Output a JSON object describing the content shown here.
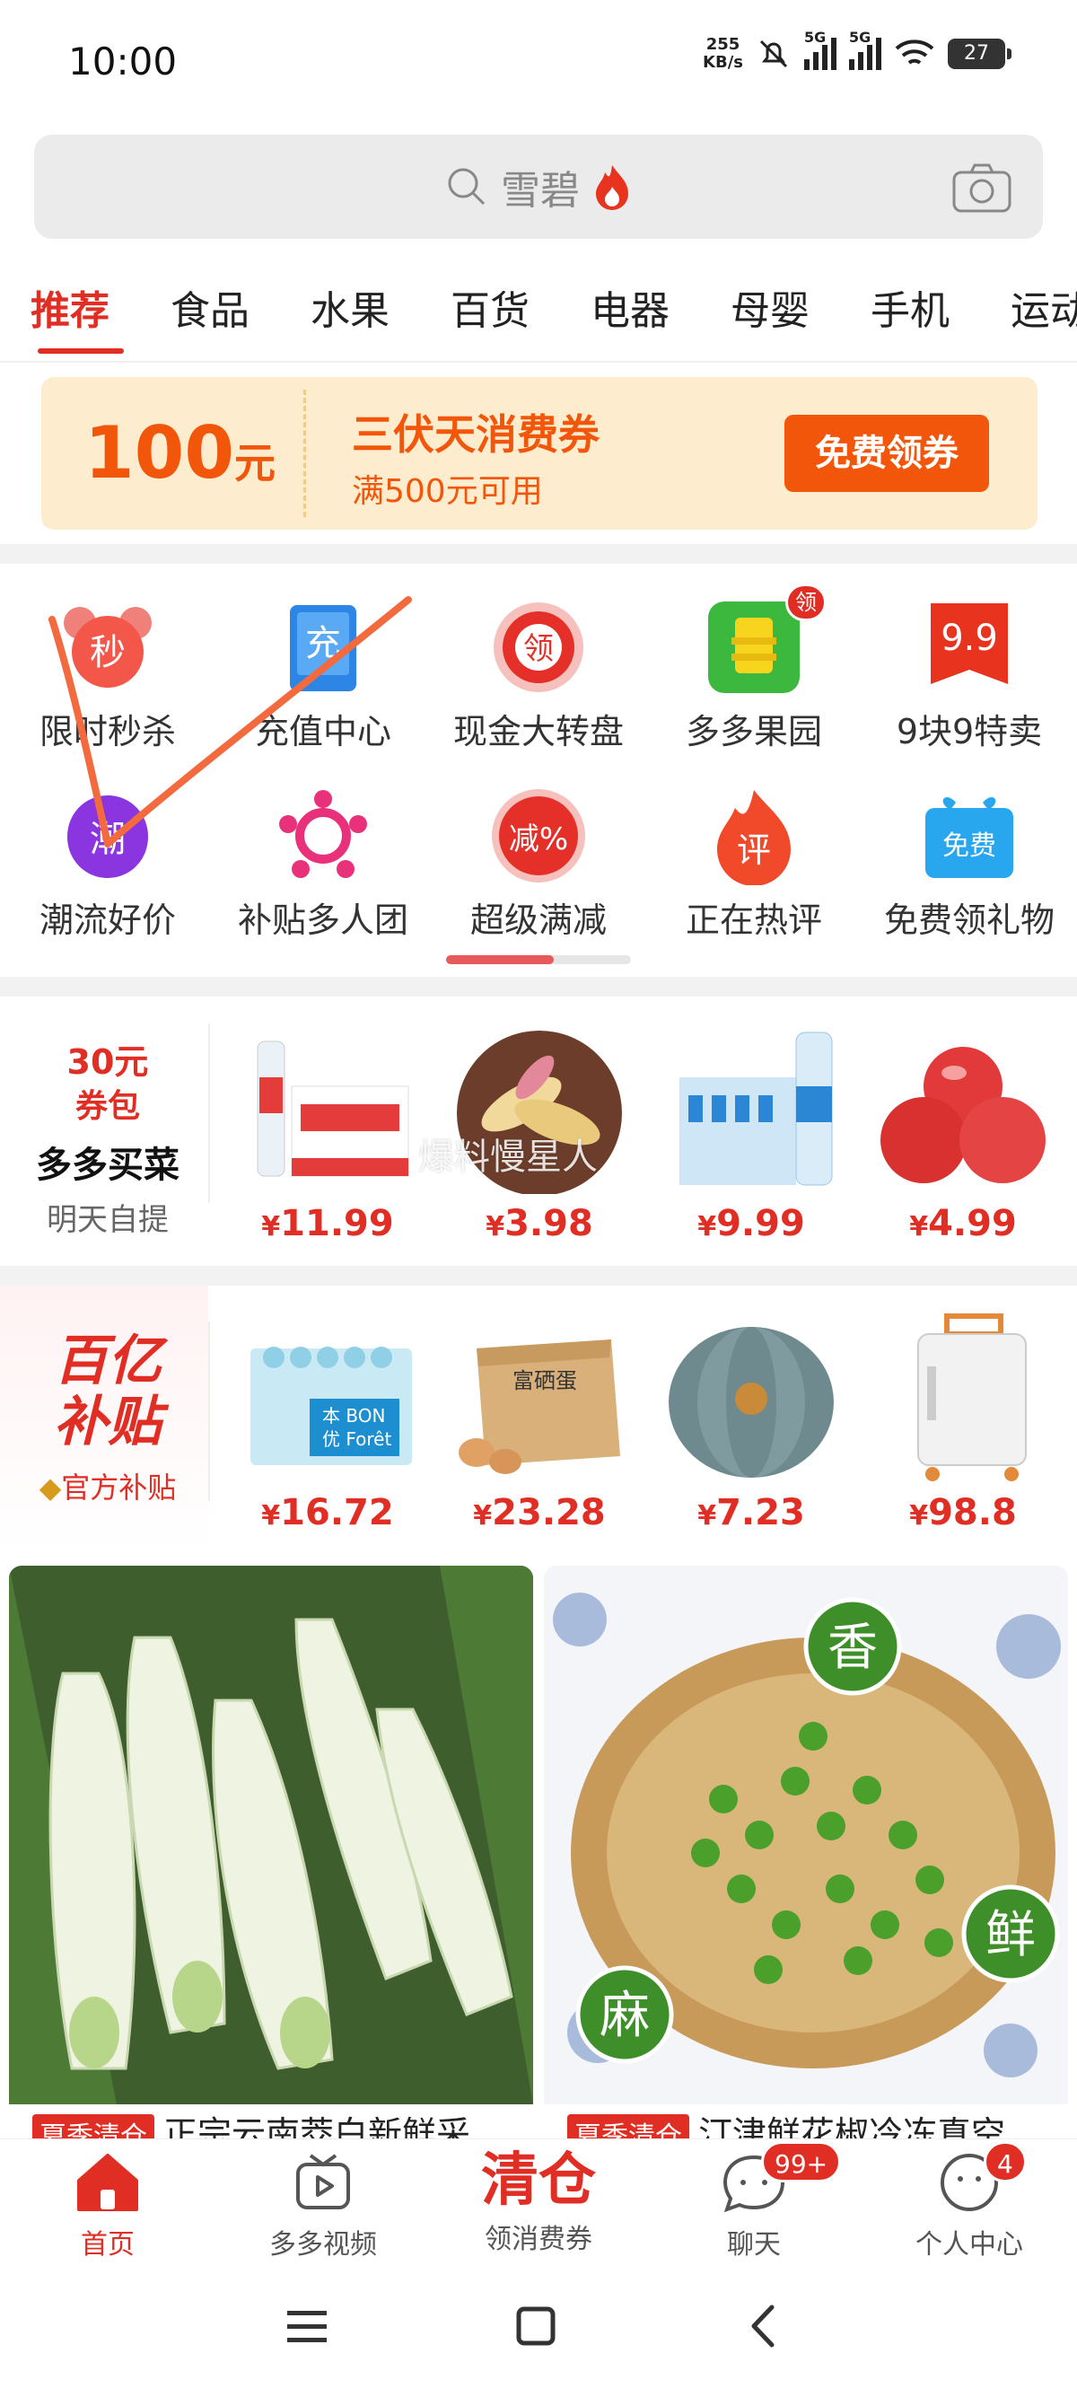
{
  "status_bar": {
    "time": "10:00",
    "net_speed_value": "255",
    "net_speed_unit": "KB/s",
    "signal1": "5G",
    "signal2": "5G",
    "battery": "27"
  },
  "search": {
    "placeholder": "雪碧"
  },
  "tabs": [
    "推荐",
    "食品",
    "水果",
    "百货",
    "电器",
    "母婴",
    "手机",
    "运动"
  ],
  "coupon": {
    "amount": "100",
    "unit": "元",
    "title": "三伏天消费券",
    "condition": "满500元可用",
    "button": "免费领券"
  },
  "grid": {
    "row1": [
      {
        "label": "限时秒杀",
        "icon": "alarm-clock-icon",
        "glyph": "秒"
      },
      {
        "label": "充值中心",
        "icon": "recharge-icon",
        "glyph": "充"
      },
      {
        "label": "现金大转盘",
        "icon": "lucky-wheel-icon",
        "glyph": "领"
      },
      {
        "label": "多多果园",
        "icon": "orchard-icon",
        "badge": "领"
      },
      {
        "label": "9块9特卖",
        "icon": "sale-99-icon",
        "glyph": "9.9"
      }
    ],
    "row2": [
      {
        "label": "潮流好价",
        "icon": "trend-icon",
        "glyph": "潮"
      },
      {
        "label": "补贴多人团",
        "icon": "group-buy-icon"
      },
      {
        "label": "超级满减",
        "icon": "discount-icon",
        "glyph": "减%"
      },
      {
        "label": "正在热评",
        "icon": "hot-review-icon",
        "glyph": "评"
      },
      {
        "label": "免费领礼物",
        "icon": "gift-icon",
        "glyph": "免费"
      }
    ]
  },
  "grocery": {
    "promo": "30元",
    "promo2": "券包",
    "title": "多多买菜",
    "subtitle": "明天自提",
    "items": [
      {
        "price": "11.99",
        "img": "water-box"
      },
      {
        "price": "3.98",
        "img": "ginger"
      },
      {
        "price": "9.99",
        "img": "bottled-water"
      },
      {
        "price": "4.99",
        "img": "pomegranate"
      }
    ]
  },
  "subsidy": {
    "title1": "百亿",
    "title2": "补贴",
    "subtitle": "官方补贴",
    "items": [
      {
        "price": "16.72",
        "img": "water-pack",
        "text1": "本 BON",
        "text2": "优 Forêt"
      },
      {
        "price": "23.28",
        "img": "egg-box",
        "text1": "富硒蛋"
      },
      {
        "price": "7.23",
        "img": "pumpkin"
      },
      {
        "price": "98.8",
        "img": "suitcase"
      }
    ]
  },
  "watermark": "爆料慢星人",
  "feed": [
    {
      "tag": "夏季清仓",
      "title": "正宗云南茭白新鲜采"
    },
    {
      "tag": "夏季清仓",
      "title": "汀津鲜花椒冷冻真空",
      "badges": [
        "香",
        "鲜",
        "麻"
      ]
    }
  ],
  "bottom_nav": {
    "home": "首页",
    "video": "多多视频",
    "center_big": "清仓",
    "center_small": "领消费券",
    "chat": "聊天",
    "chat_badge": "99+",
    "profile": "个人中心",
    "profile_badge": "4"
  },
  "colors": {
    "brand": "#e02e24",
    "coupon_orange": "#f2560a",
    "coupon_bg": "#fdeccd"
  }
}
